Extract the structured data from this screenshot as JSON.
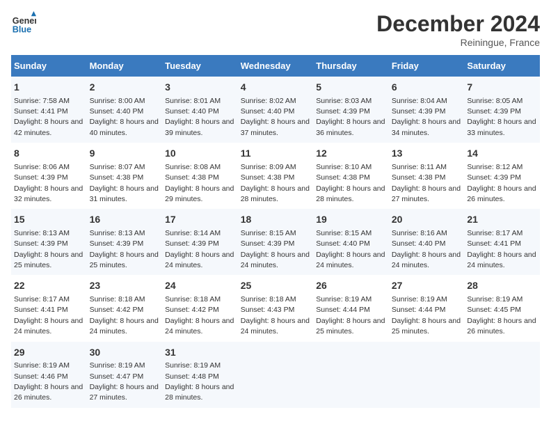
{
  "header": {
    "logo_line1": "General",
    "logo_line2": "Blue",
    "month_year": "December 2024",
    "location": "Reiningue, France"
  },
  "days_of_week": [
    "Sunday",
    "Monday",
    "Tuesday",
    "Wednesday",
    "Thursday",
    "Friday",
    "Saturday"
  ],
  "weeks": [
    [
      {
        "day": "1",
        "sunrise": "7:58 AM",
        "sunset": "4:41 PM",
        "daylight": "8 hours and 42 minutes."
      },
      {
        "day": "2",
        "sunrise": "8:00 AM",
        "sunset": "4:40 PM",
        "daylight": "8 hours and 40 minutes."
      },
      {
        "day": "3",
        "sunrise": "8:01 AM",
        "sunset": "4:40 PM",
        "daylight": "8 hours and 39 minutes."
      },
      {
        "day": "4",
        "sunrise": "8:02 AM",
        "sunset": "4:40 PM",
        "daylight": "8 hours and 37 minutes."
      },
      {
        "day": "5",
        "sunrise": "8:03 AM",
        "sunset": "4:39 PM",
        "daylight": "8 hours and 36 minutes."
      },
      {
        "day": "6",
        "sunrise": "8:04 AM",
        "sunset": "4:39 PM",
        "daylight": "8 hours and 34 minutes."
      },
      {
        "day": "7",
        "sunrise": "8:05 AM",
        "sunset": "4:39 PM",
        "daylight": "8 hours and 33 minutes."
      }
    ],
    [
      {
        "day": "8",
        "sunrise": "8:06 AM",
        "sunset": "4:39 PM",
        "daylight": "8 hours and 32 minutes."
      },
      {
        "day": "9",
        "sunrise": "8:07 AM",
        "sunset": "4:38 PM",
        "daylight": "8 hours and 31 minutes."
      },
      {
        "day": "10",
        "sunrise": "8:08 AM",
        "sunset": "4:38 PM",
        "daylight": "8 hours and 29 minutes."
      },
      {
        "day": "11",
        "sunrise": "8:09 AM",
        "sunset": "4:38 PM",
        "daylight": "8 hours and 28 minutes."
      },
      {
        "day": "12",
        "sunrise": "8:10 AM",
        "sunset": "4:38 PM",
        "daylight": "8 hours and 28 minutes."
      },
      {
        "day": "13",
        "sunrise": "8:11 AM",
        "sunset": "4:38 PM",
        "daylight": "8 hours and 27 minutes."
      },
      {
        "day": "14",
        "sunrise": "8:12 AM",
        "sunset": "4:39 PM",
        "daylight": "8 hours and 26 minutes."
      }
    ],
    [
      {
        "day": "15",
        "sunrise": "8:13 AM",
        "sunset": "4:39 PM",
        "daylight": "8 hours and 25 minutes."
      },
      {
        "day": "16",
        "sunrise": "8:13 AM",
        "sunset": "4:39 PM",
        "daylight": "8 hours and 25 minutes."
      },
      {
        "day": "17",
        "sunrise": "8:14 AM",
        "sunset": "4:39 PM",
        "daylight": "8 hours and 24 minutes."
      },
      {
        "day": "18",
        "sunrise": "8:15 AM",
        "sunset": "4:39 PM",
        "daylight": "8 hours and 24 minutes."
      },
      {
        "day": "19",
        "sunrise": "8:15 AM",
        "sunset": "4:40 PM",
        "daylight": "8 hours and 24 minutes."
      },
      {
        "day": "20",
        "sunrise": "8:16 AM",
        "sunset": "4:40 PM",
        "daylight": "8 hours and 24 minutes."
      },
      {
        "day": "21",
        "sunrise": "8:17 AM",
        "sunset": "4:41 PM",
        "daylight": "8 hours and 24 minutes."
      }
    ],
    [
      {
        "day": "22",
        "sunrise": "8:17 AM",
        "sunset": "4:41 PM",
        "daylight": "8 hours and 24 minutes."
      },
      {
        "day": "23",
        "sunrise": "8:18 AM",
        "sunset": "4:42 PM",
        "daylight": "8 hours and 24 minutes."
      },
      {
        "day": "24",
        "sunrise": "8:18 AM",
        "sunset": "4:42 PM",
        "daylight": "8 hours and 24 minutes."
      },
      {
        "day": "25",
        "sunrise": "8:18 AM",
        "sunset": "4:43 PM",
        "daylight": "8 hours and 24 minutes."
      },
      {
        "day": "26",
        "sunrise": "8:19 AM",
        "sunset": "4:44 PM",
        "daylight": "8 hours and 25 minutes."
      },
      {
        "day": "27",
        "sunrise": "8:19 AM",
        "sunset": "4:44 PM",
        "daylight": "8 hours and 25 minutes."
      },
      {
        "day": "28",
        "sunrise": "8:19 AM",
        "sunset": "4:45 PM",
        "daylight": "8 hours and 26 minutes."
      }
    ],
    [
      {
        "day": "29",
        "sunrise": "8:19 AM",
        "sunset": "4:46 PM",
        "daylight": "8 hours and 26 minutes."
      },
      {
        "day": "30",
        "sunrise": "8:19 AM",
        "sunset": "4:47 PM",
        "daylight": "8 hours and 27 minutes."
      },
      {
        "day": "31",
        "sunrise": "8:19 AM",
        "sunset": "4:48 PM",
        "daylight": "8 hours and 28 minutes."
      },
      null,
      null,
      null,
      null
    ]
  ]
}
